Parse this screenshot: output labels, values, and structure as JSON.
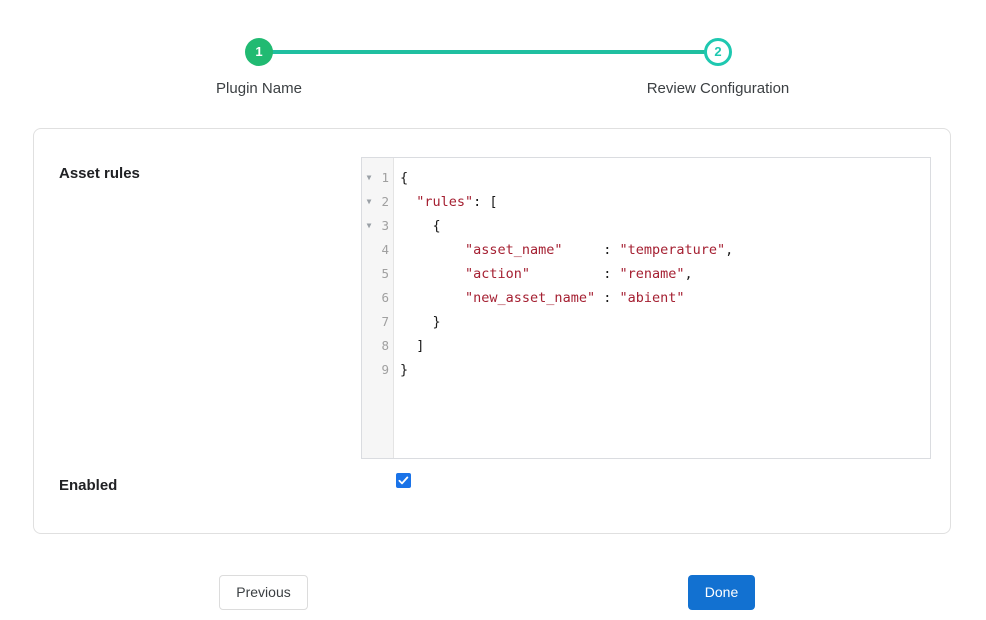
{
  "stepper": {
    "steps": [
      {
        "number": "1",
        "label": "Plugin Name",
        "state": "done"
      },
      {
        "number": "2",
        "label": "Review Configuration",
        "state": "current"
      }
    ],
    "accent_line_color": "#20bfa0",
    "done_color": "#21ba72",
    "current_color": "#1ec8b0"
  },
  "form": {
    "asset_rules": {
      "label": "Asset rules",
      "editor": {
        "lines": [
          {
            "number": "1",
            "foldable": true,
            "tokens": [
              {
                "text": "{",
                "type": "punct"
              }
            ]
          },
          {
            "number": "2",
            "foldable": true,
            "tokens": [
              {
                "text": "  ",
                "type": "punct"
              },
              {
                "text": "\"rules\"",
                "type": "str"
              },
              {
                "text": ": [",
                "type": "punct"
              }
            ]
          },
          {
            "number": "3",
            "foldable": true,
            "tokens": [
              {
                "text": "    {",
                "type": "punct"
              }
            ]
          },
          {
            "number": "4",
            "foldable": false,
            "tokens": [
              {
                "text": "        ",
                "type": "punct"
              },
              {
                "text": "\"asset_name\"",
                "type": "str"
              },
              {
                "text": "     : ",
                "type": "punct"
              },
              {
                "text": "\"temperature\"",
                "type": "str"
              },
              {
                "text": ",",
                "type": "punct"
              }
            ]
          },
          {
            "number": "5",
            "foldable": false,
            "tokens": [
              {
                "text": "        ",
                "type": "punct"
              },
              {
                "text": "\"action\"",
                "type": "str"
              },
              {
                "text": "         : ",
                "type": "punct"
              },
              {
                "text": "\"rename\"",
                "type": "str"
              },
              {
                "text": ",",
                "type": "punct"
              }
            ]
          },
          {
            "number": "6",
            "foldable": false,
            "tokens": [
              {
                "text": "        ",
                "type": "punct"
              },
              {
                "text": "\"new_asset_name\"",
                "type": "str"
              },
              {
                "text": " : ",
                "type": "punct"
              },
              {
                "text": "\"abient\"",
                "type": "str"
              }
            ]
          },
          {
            "number": "7",
            "foldable": false,
            "tokens": [
              {
                "text": "    }",
                "type": "punct"
              }
            ]
          },
          {
            "number": "8",
            "foldable": false,
            "tokens": [
              {
                "text": "  ]",
                "type": "punct"
              }
            ]
          },
          {
            "number": "9",
            "foldable": false,
            "tokens": [
              {
                "text": "}",
                "type": "punct"
              }
            ]
          }
        ],
        "fold_glyph": "▼"
      }
    },
    "enabled": {
      "label": "Enabled",
      "checked": true,
      "checkbox_color": "#1a73e8"
    }
  },
  "footer": {
    "previous_label": "Previous",
    "done_label": "Done",
    "done_color": "#1271d1"
  }
}
